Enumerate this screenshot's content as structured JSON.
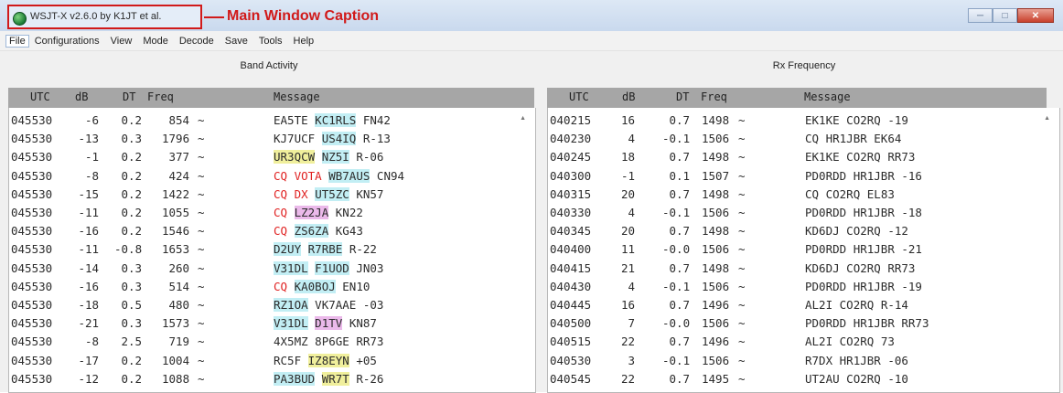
{
  "titlebar": {
    "title": "WSJT-X  v2.6.0  by K1JT et al.",
    "annotation": "Main Window Caption",
    "buttons": [
      "minimize",
      "maximize",
      "close"
    ]
  },
  "menu": [
    "File",
    "Configurations",
    "View",
    "Mode",
    "Decode",
    "Save",
    "Tools",
    "Help"
  ],
  "colors": {
    "annotation": "#d11a1a",
    "cq": "#e02222",
    "highlight_cyan": "#c2eef4",
    "highlight_yellow": "#f0ef9c",
    "highlight_purple": "#ebb9ea",
    "header_bg": "#a6a6a6"
  },
  "band_activity": {
    "title": "Band Activity",
    "columns": [
      "UTC",
      "dB",
      "DT",
      "Freq",
      "Message"
    ],
    "rows": [
      {
        "utc": "045530",
        "db": "-6",
        "dt": "0.2",
        "freq": "854",
        "msg": [
          {
            "t": "EA5TE"
          },
          {
            "t": "KC1RLS",
            "s": "cyan"
          },
          {
            "t": "FN42"
          }
        ]
      },
      {
        "utc": "045530",
        "db": "-13",
        "dt": "0.3",
        "freq": "1796",
        "msg": [
          {
            "t": "KJ7UCF"
          },
          {
            "t": "US4IQ",
            "s": "cyan"
          },
          {
            "t": "R-13"
          }
        ]
      },
      {
        "utc": "045530",
        "db": "-1",
        "dt": "0.2",
        "freq": "377",
        "msg": [
          {
            "t": "UR3QCW",
            "s": "yellow"
          },
          {
            "t": "NZ5I",
            "s": "cyan"
          },
          {
            "t": "R-06"
          }
        ]
      },
      {
        "utc": "045530",
        "db": "-8",
        "dt": "0.2",
        "freq": "424",
        "msg": [
          {
            "t": "CQ",
            "s": "red"
          },
          {
            "t": "VOTA",
            "s": "red"
          },
          {
            "t": "WB7AUS",
            "s": "cyan"
          },
          {
            "t": "CN94"
          }
        ]
      },
      {
        "utc": "045530",
        "db": "-15",
        "dt": "0.2",
        "freq": "1422",
        "msg": [
          {
            "t": "CQ",
            "s": "red"
          },
          {
            "t": "DX",
            "s": "red"
          },
          {
            "t": "UT5ZC",
            "s": "cyan"
          },
          {
            "t": "KN57"
          }
        ]
      },
      {
        "utc": "045530",
        "db": "-11",
        "dt": "0.2",
        "freq": "1055",
        "msg": [
          {
            "t": "CQ",
            "s": "red"
          },
          {
            "t": "LZ2JA",
            "s": "purple"
          },
          {
            "t": "KN22"
          }
        ]
      },
      {
        "utc": "045530",
        "db": "-16",
        "dt": "0.2",
        "freq": "1546",
        "msg": [
          {
            "t": "CQ",
            "s": "red"
          },
          {
            "t": "ZS6ZA",
            "s": "cyan"
          },
          {
            "t": "KG43"
          }
        ]
      },
      {
        "utc": "045530",
        "db": "-11",
        "dt": "-0.8",
        "freq": "1653",
        "msg": [
          {
            "t": "D2UY",
            "s": "cyan"
          },
          {
            "t": "R7RBE",
            "s": "cyan"
          },
          {
            "t": "R-22"
          }
        ]
      },
      {
        "utc": "045530",
        "db": "-14",
        "dt": "0.3",
        "freq": "260",
        "msg": [
          {
            "t": "V31DL",
            "s": "cyan"
          },
          {
            "t": "F1UOD",
            "s": "cyan"
          },
          {
            "t": "JN03"
          }
        ]
      },
      {
        "utc": "045530",
        "db": "-16",
        "dt": "0.3",
        "freq": "514",
        "msg": [
          {
            "t": "CQ",
            "s": "red"
          },
          {
            "t": "KA0BOJ",
            "s": "cyan"
          },
          {
            "t": "EN10"
          }
        ]
      },
      {
        "utc": "045530",
        "db": "-18",
        "dt": "0.5",
        "freq": "480",
        "msg": [
          {
            "t": "RZ1OA",
            "s": "cyan"
          },
          {
            "t": "VK7AAE"
          },
          {
            "t": "-03"
          }
        ]
      },
      {
        "utc": "045530",
        "db": "-21",
        "dt": "0.3",
        "freq": "1573",
        "msg": [
          {
            "t": "V31DL",
            "s": "cyan"
          },
          {
            "t": "D1TV",
            "s": "purple"
          },
          {
            "t": "KN87"
          }
        ]
      },
      {
        "utc": "045530",
        "db": "-8",
        "dt": "2.5",
        "freq": "719",
        "msg": [
          {
            "t": "4X5MZ"
          },
          {
            "t": "8P6GE"
          },
          {
            "t": "RR73"
          }
        ]
      },
      {
        "utc": "045530",
        "db": "-17",
        "dt": "0.2",
        "freq": "1004",
        "msg": [
          {
            "t": "RC5F"
          },
          {
            "t": "IZ8EYN",
            "s": "yellow"
          },
          {
            "t": "+05"
          }
        ]
      },
      {
        "utc": "045530",
        "db": "-12",
        "dt": "0.2",
        "freq": "1088",
        "msg": [
          {
            "t": "PA3BUD",
            "s": "cyan"
          },
          {
            "t": "WR7T",
            "s": "yellow"
          },
          {
            "t": "R-26"
          }
        ]
      }
    ]
  },
  "rx_frequency": {
    "title": "Rx Frequency",
    "columns": [
      "UTC",
      "dB",
      "DT",
      "Freq",
      "Message"
    ],
    "rows": [
      {
        "utc": "040215",
        "db": "16",
        "dt": "0.7",
        "freq": "1498",
        "msg": [
          {
            "t": "EK1KE"
          },
          {
            "t": "CO2RQ"
          },
          {
            "t": "-19"
          }
        ]
      },
      {
        "utc": "040230",
        "db": "4",
        "dt": "-0.1",
        "freq": "1506",
        "msg": [
          {
            "t": "CQ"
          },
          {
            "t": "HR1JBR"
          },
          {
            "t": "EK64"
          }
        ]
      },
      {
        "utc": "040245",
        "db": "18",
        "dt": "0.7",
        "freq": "1498",
        "msg": [
          {
            "t": "EK1KE"
          },
          {
            "t": "CO2RQ"
          },
          {
            "t": "RR73"
          }
        ]
      },
      {
        "utc": "040300",
        "db": "-1",
        "dt": "0.1",
        "freq": "1507",
        "msg": [
          {
            "t": "PD0RDD"
          },
          {
            "t": "HR1JBR"
          },
          {
            "t": "-16"
          }
        ]
      },
      {
        "utc": "040315",
        "db": "20",
        "dt": "0.7",
        "freq": "1498",
        "msg": [
          {
            "t": "CQ"
          },
          {
            "t": "CO2RQ"
          },
          {
            "t": "EL83"
          }
        ]
      },
      {
        "utc": "040330",
        "db": "4",
        "dt": "-0.1",
        "freq": "1506",
        "msg": [
          {
            "t": "PD0RDD"
          },
          {
            "t": "HR1JBR"
          },
          {
            "t": "-18"
          }
        ]
      },
      {
        "utc": "040345",
        "db": "20",
        "dt": "0.7",
        "freq": "1498",
        "msg": [
          {
            "t": "KD6DJ"
          },
          {
            "t": "CO2RQ"
          },
          {
            "t": "-12"
          }
        ]
      },
      {
        "utc": "040400",
        "db": "11",
        "dt": "-0.0",
        "freq": "1506",
        "msg": [
          {
            "t": "PD0RDD"
          },
          {
            "t": "HR1JBR"
          },
          {
            "t": "-21"
          }
        ]
      },
      {
        "utc": "040415",
        "db": "21",
        "dt": "0.7",
        "freq": "1498",
        "msg": [
          {
            "t": "KD6DJ"
          },
          {
            "t": "CO2RQ"
          },
          {
            "t": "RR73"
          }
        ]
      },
      {
        "utc": "040430",
        "db": "4",
        "dt": "-0.1",
        "freq": "1506",
        "msg": [
          {
            "t": "PD0RDD"
          },
          {
            "t": "HR1JBR"
          },
          {
            "t": "-19"
          }
        ]
      },
      {
        "utc": "040445",
        "db": "16",
        "dt": "0.7",
        "freq": "1496",
        "msg": [
          {
            "t": "AL2I"
          },
          {
            "t": "CO2RQ"
          },
          {
            "t": "R-14"
          }
        ]
      },
      {
        "utc": "040500",
        "db": "7",
        "dt": "-0.0",
        "freq": "1506",
        "msg": [
          {
            "t": "PD0RDD"
          },
          {
            "t": "HR1JBR"
          },
          {
            "t": "RR73"
          }
        ]
      },
      {
        "utc": "040515",
        "db": "22",
        "dt": "0.7",
        "freq": "1496",
        "msg": [
          {
            "t": "AL2I"
          },
          {
            "t": "CO2RQ"
          },
          {
            "t": "73"
          }
        ]
      },
      {
        "utc": "040530",
        "db": "3",
        "dt": "-0.1",
        "freq": "1506",
        "msg": [
          {
            "t": "R7DX"
          },
          {
            "t": "HR1JBR"
          },
          {
            "t": "-06"
          }
        ]
      },
      {
        "utc": "040545",
        "db": "22",
        "dt": "0.7",
        "freq": "1495",
        "msg": [
          {
            "t": "UT2AU"
          },
          {
            "t": "CO2RQ"
          },
          {
            "t": "-10"
          }
        ]
      }
    ]
  }
}
